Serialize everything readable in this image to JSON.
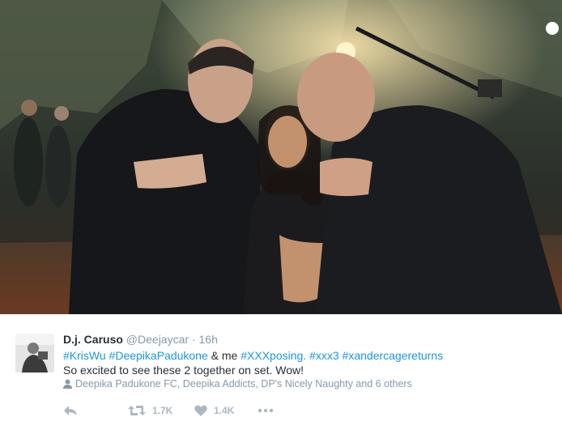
{
  "tweet": {
    "author_name": "D.j. Caruso",
    "handle": "@Deejaycar",
    "separator": "·",
    "time": "16h",
    "line1": {
      "tags": [
        "#KrisWu",
        "#DeepikaPadukone"
      ],
      "middle": "& me",
      "tags2": [
        "#XXXposing.",
        "#xxx3",
        "#xandercagereturns"
      ]
    },
    "line2": "So excited to see these 2 together on set. Wow!",
    "liked_by": "Deepika Padukone FC, Deepika Addicts, DP's Nicely Naughty and 6 others"
  },
  "actions": {
    "reply_icon": "reply-icon",
    "retweet_icon": "retweet-icon",
    "retweets": "1.7K",
    "like_icon": "heart-icon",
    "likes": "1.4K",
    "more_icon": "more-icon"
  },
  "colors": {
    "link": "#1b95e0",
    "text": "#292f33",
    "muted": "#8899a6",
    "action": "#aab8c2"
  }
}
